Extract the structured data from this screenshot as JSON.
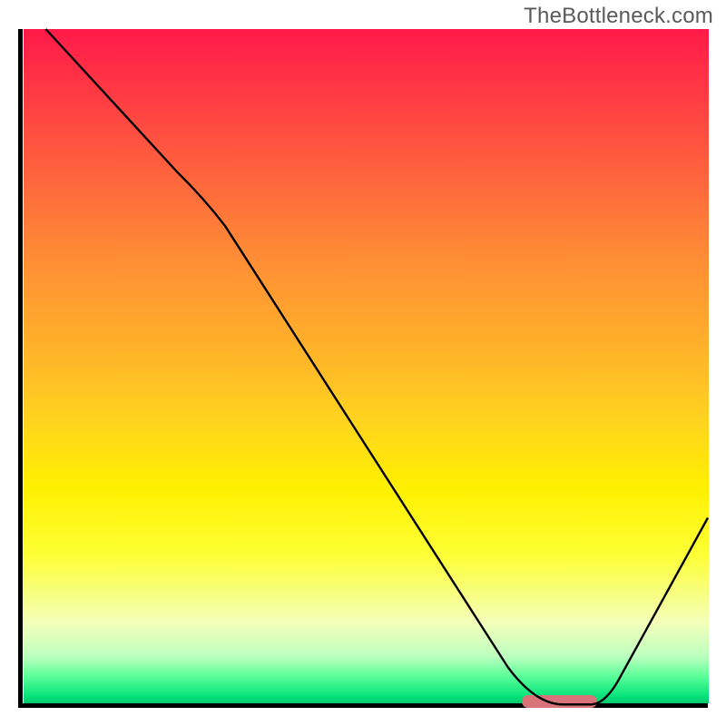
{
  "watermark": "TheBottleneck.com",
  "chart_data": {
    "type": "line",
    "title": "",
    "xlabel": "",
    "ylabel": "",
    "xlim": [
      0,
      100
    ],
    "ylim": [
      0,
      100
    ],
    "grid": false,
    "series": [
      {
        "name": "bottleneck-curve",
        "x": [
          4,
          24,
          30,
          74,
          78,
          83,
          100
        ],
        "y": [
          100,
          78,
          72,
          3,
          0.5,
          0.5,
          28
        ]
      }
    ],
    "background_gradient": {
      "top": "#ff1a49",
      "mid": "#fff000",
      "bottom": "#04c96b"
    },
    "marker": {
      "name": "optimal-range",
      "x_start": 73,
      "x_end": 84,
      "y": 1,
      "color": "#d9737a"
    }
  }
}
